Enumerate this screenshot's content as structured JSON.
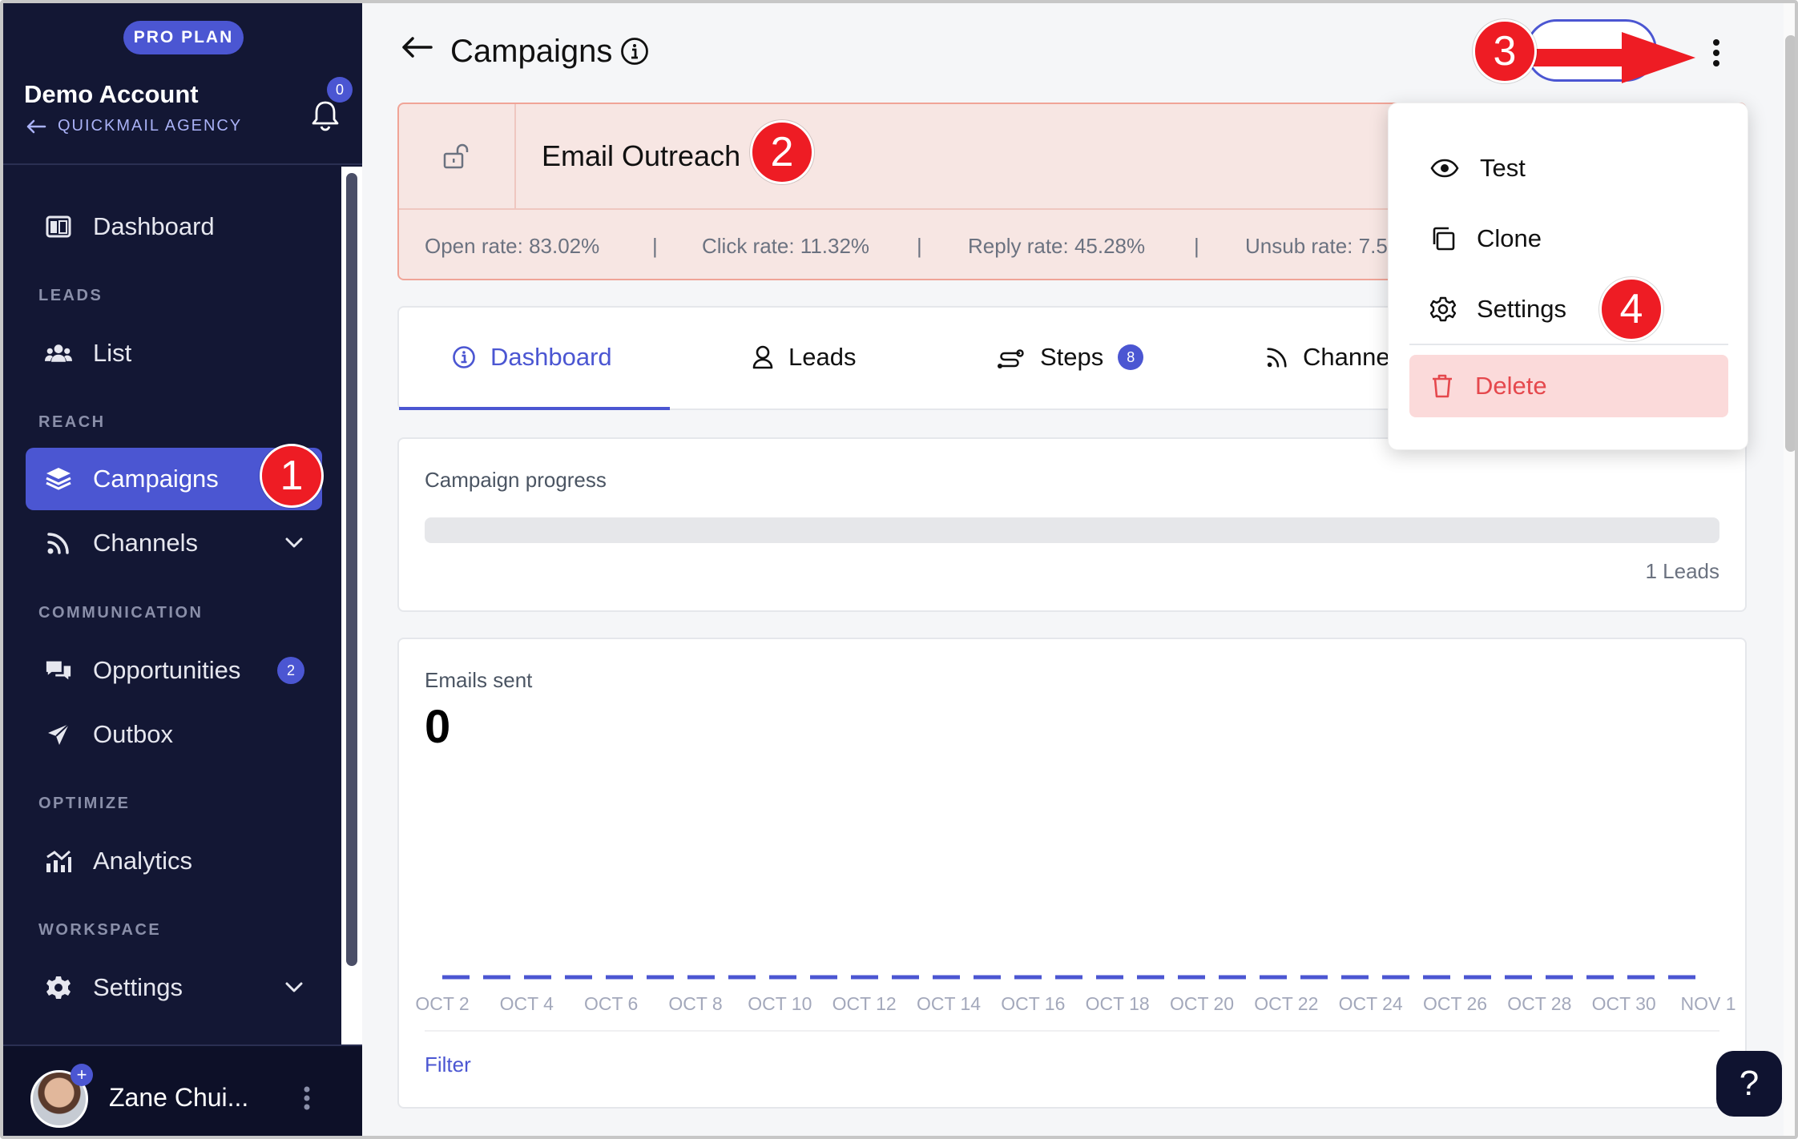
{
  "sidebar": {
    "plan": "PRO PLAN",
    "account_name": "Demo Account",
    "account_sub": "QUICKMAIL AGENCY",
    "notifications": "0",
    "sections": {
      "leads": "LEADS",
      "reach": "REACH",
      "communication": "COMMUNICATION",
      "optimize": "OPTIMIZE",
      "workspace": "WORKSPACE"
    },
    "items": {
      "dashboard": "Dashboard",
      "list": "List",
      "campaigns": "Campaigns",
      "channels": "Channels",
      "opportunities": "Opportunities",
      "opportunities_count": "2",
      "outbox": "Outbox",
      "analytics": "Analytics",
      "settings": "Settings"
    },
    "user": {
      "name": "Zane Chui...",
      "plus": "+"
    }
  },
  "header": {
    "title": "Campaigns"
  },
  "campaign": {
    "name": "Email Outreach",
    "stats": {
      "open": "Open rate: 83.02%",
      "click": "Click rate: 11.32%",
      "reply": "Reply rate: 45.28%",
      "unsub": "Unsub rate: 7.5",
      "sep": "|"
    }
  },
  "tabs": {
    "dashboard": "Dashboard",
    "leads": "Leads",
    "steps": "Steps",
    "steps_count": "8",
    "channels": "Channe"
  },
  "progress": {
    "label": "Campaign progress",
    "leads": "1 Leads",
    "fraction": 0
  },
  "emails": {
    "label": "Emails sent",
    "total": "0",
    "filter": "Filter"
  },
  "chart_data": {
    "type": "line",
    "x": [
      "OCT 2",
      "OCT 4",
      "OCT 6",
      "OCT 8",
      "OCT 10",
      "OCT 12",
      "OCT 14",
      "OCT 16",
      "OCT 18",
      "OCT 20",
      "OCT 22",
      "OCT 24",
      "OCT 26",
      "OCT 28",
      "OCT 30",
      "NOV 1"
    ],
    "series": [
      {
        "values": [
          0,
          0,
          0,
          0,
          0,
          0,
          0,
          0,
          0,
          0,
          0,
          0,
          0,
          0,
          0,
          0
        ],
        "color": "#4b56d2",
        "style": "dashed"
      }
    ],
    "title": "",
    "xlabel": "",
    "ylabel": ""
  },
  "menu": {
    "test": "Test",
    "clone": "Clone",
    "settings": "Settings",
    "delete": "Delete"
  },
  "help": "?",
  "annotations": [
    "1",
    "2",
    "3",
    "4"
  ],
  "colors": {
    "accent": "#4b56d2",
    "sidebar": "#131734",
    "danger": "#e5484d",
    "annotation": "#ee1c24"
  }
}
